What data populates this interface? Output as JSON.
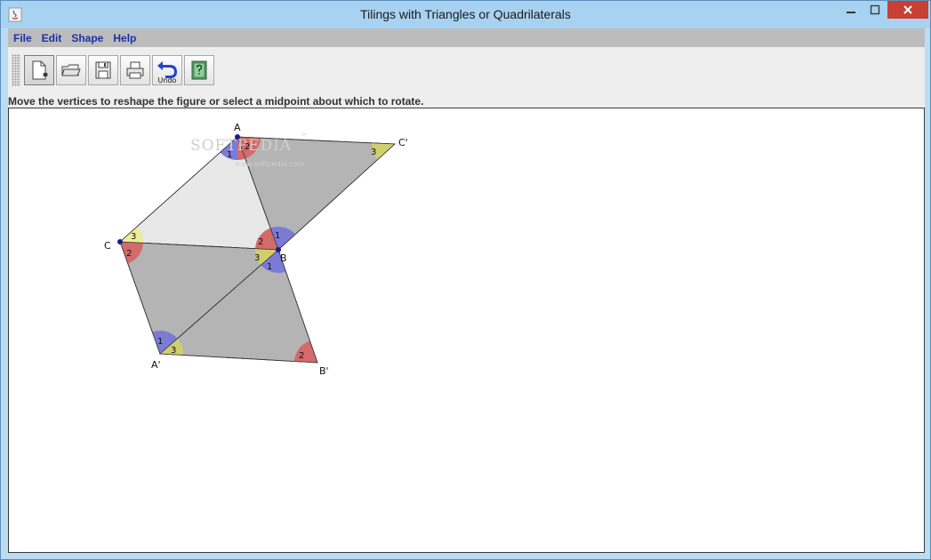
{
  "window": {
    "title": "Tilings with Triangles or Quadrilaterals"
  },
  "menu": [
    "File",
    "Edit",
    "Shape",
    "Help"
  ],
  "toolbar": {
    "undo_label": "Undo"
  },
  "instruction": "Move the vertices to reshape the figure or select a midpoint about which to rotate.",
  "watermark": {
    "main": "SOFTPEDIA",
    "tm": "™",
    "sub": "www.softpedia.com"
  },
  "canvas": {
    "vertex_labels": {
      "A": "A",
      "B": "B",
      "C": "C",
      "A_prime": "A'",
      "B_prime": "B'",
      "C_prime": "C'"
    },
    "angle_labels": {
      "one": "1",
      "two": "2",
      "three": "3"
    }
  },
  "colors": {
    "angle_1": "#7b7bd6",
    "angle_2": "#d46a6a",
    "angle_3": "#cfcf6e",
    "angle_3_light": "#ecec9a",
    "shape_dark": "#b4b4b4",
    "shape_light": "#e8e8e8"
  }
}
